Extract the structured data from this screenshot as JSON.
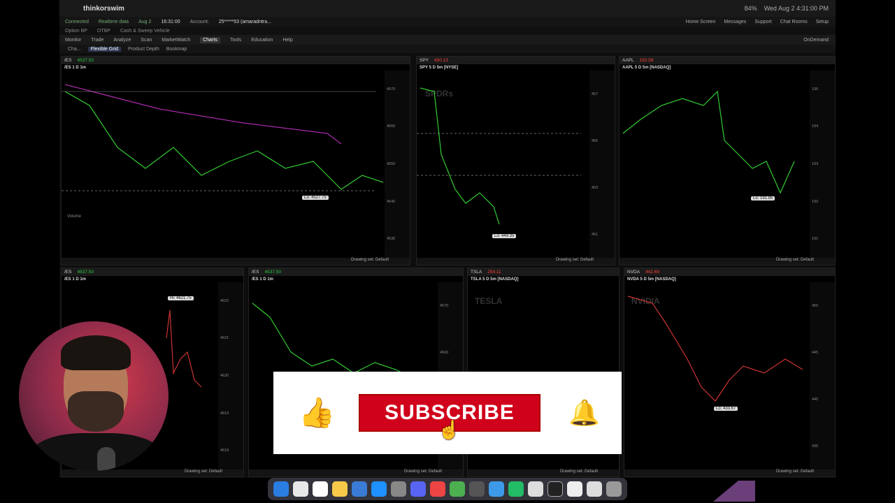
{
  "menubar": {
    "app_name": "thinkorswim",
    "clock": "Wed Aug 2 4:31:00 PM",
    "battery": "84%"
  },
  "app": {
    "status": [
      "Connected",
      "Realtime data",
      "Aug 2",
      "16:31:00",
      "Account:"
    ],
    "account": "25*****53 (amaradntra...",
    "right_items": [
      "Home Screen",
      "Messages",
      "Support",
      "Chat Rooms",
      "Setup"
    ],
    "nav": [
      "Option BP",
      "OTBP",
      "Cash & Sweep Vehicle"
    ],
    "menu": [
      "Monitor",
      "Trade",
      "Analyze",
      "Scan",
      "MarketWatch",
      "Charts",
      "Tools",
      "Education",
      "Help"
    ],
    "menu_active": "Charts",
    "ondemand": "OnDemand",
    "tabs": [
      "Cha...",
      "Flexible Grid",
      "Product Depth",
      "Bookmap"
    ],
    "tab_active": "Flexible Grid"
  },
  "charts": [
    {
      "symbol": "/ES",
      "price": "4537.50",
      "title": "/ES 1 D 1m",
      "low": "Lo: 4527.75",
      "time": "14:40",
      "axis": [
        "4570",
        "4560",
        "4550",
        "4540",
        "4530"
      ],
      "footer": "Drawing set: Default"
    },
    {
      "symbol": "SPY",
      "price": "450.13",
      "title": "SPY 5 D 5m [NYSE]",
      "low": "Lo: 449.35",
      "watermark": "SPDRs",
      "axis": [
        "457",
        "456",
        "455",
        "454",
        "453",
        "452",
        "451",
        "450"
      ],
      "footer": "Drawing set: Default"
    },
    {
      "symbol": "AAPL",
      "price": "192.58",
      "title": "AAPL 5 D 5m [NASDAQ]",
      "low": "Lo: 191.85",
      "axis": [
        "195",
        "194",
        "193",
        "192",
        "191"
      ],
      "footer": "Drawing set: Default"
    },
    {
      "symbol": "/ES",
      "price": "4537.50",
      "title": "/ES 1 D 1m",
      "high": "Hi: 4621.75",
      "axis": [
        "4622",
        "4621",
        "4620",
        "4619",
        "4618"
      ],
      "footer": "Drawing set: Default"
    },
    {
      "symbol": "/ES",
      "price": "4537.50",
      "title": "/ES 1 D 1m",
      "axis": [
        "4570",
        "4560",
        "4550",
        "4540"
      ],
      "footer": "Drawing set: Default"
    },
    {
      "symbol": "TSLA",
      "price": "254.11",
      "title": "TSLA 5 D 5m [NASDAQ]",
      "watermark": "TESLA",
      "axis": [],
      "footer": "Drawing set: Default"
    },
    {
      "symbol": "NVDA",
      "price": "442.69",
      "title": "NVDA 5 D 5m [NASDAQ]",
      "low": "Lo: 433.67",
      "watermark": "NVIDIA",
      "axis": [
        "450",
        "445",
        "440",
        "435"
      ],
      "footer": "Drawing set: Default"
    }
  ],
  "overlay": {
    "subscribe_label": "SUBSCRIBE",
    "thumb_icon": "thumbs-up-icon",
    "bell_icon": "bell-icon"
  },
  "volume_label": "Volume"
}
